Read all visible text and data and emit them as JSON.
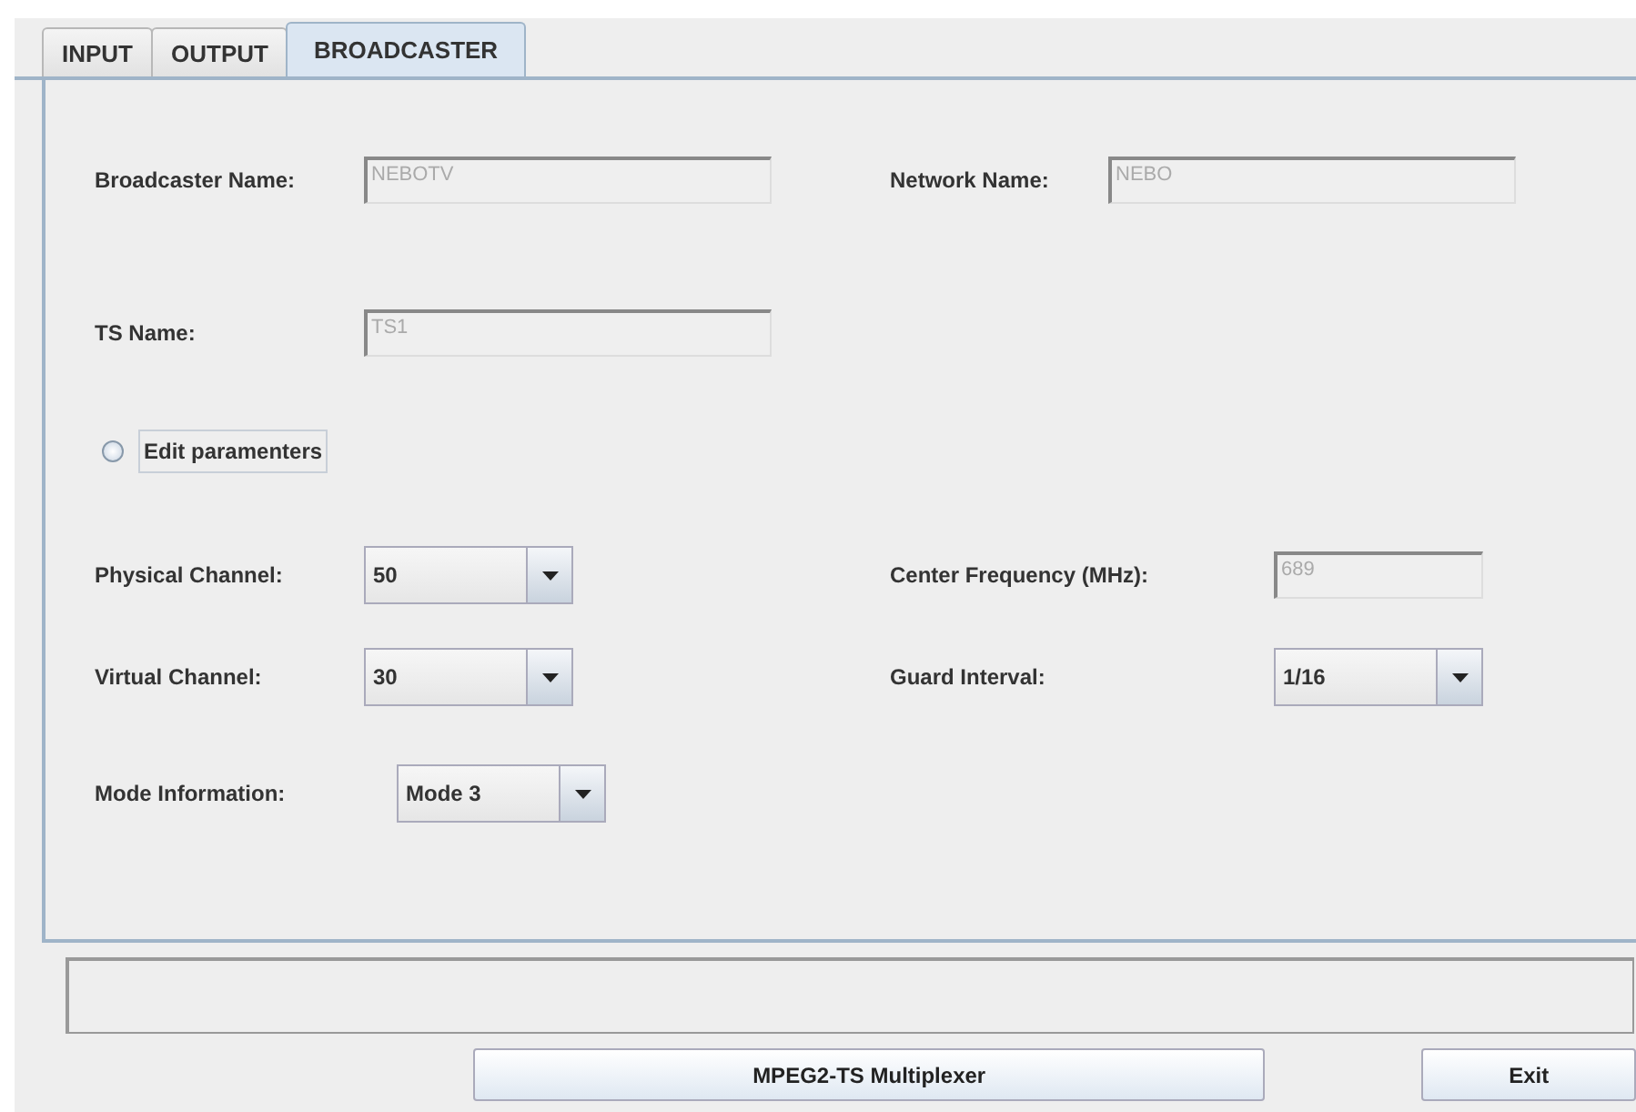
{
  "tabs": [
    {
      "label": "INPUT",
      "selected": false
    },
    {
      "label": "OUTPUT",
      "selected": false
    },
    {
      "label": "BROADCASTER",
      "selected": true
    }
  ],
  "broadcaster_name": {
    "label": "Broadcaster Name:",
    "value": "NEBOTV",
    "disabled": true
  },
  "network_name": {
    "label": "Network Name:",
    "value": "NEBO",
    "disabled": true
  },
  "ts_name": {
    "label": "TS Name:",
    "value": "TS1",
    "disabled": true
  },
  "edit_parameters": {
    "label": "Edit paramenters",
    "checked": false
  },
  "physical_channel": {
    "label": "Physical Channel:",
    "value": "50"
  },
  "center_frequency": {
    "label": "Center Frequency (MHz):",
    "value": "689",
    "disabled": true
  },
  "virtual_channel": {
    "label": "Virtual Channel:",
    "value": "30"
  },
  "guard_interval": {
    "label": "Guard Interval:",
    "value": "1/16"
  },
  "mode_information": {
    "label": "Mode Information:",
    "value": "Mode 3"
  },
  "buttons": [
    {
      "label": "MPEG2-TS Multiplexer"
    },
    {
      "label": "Exit"
    }
  ]
}
